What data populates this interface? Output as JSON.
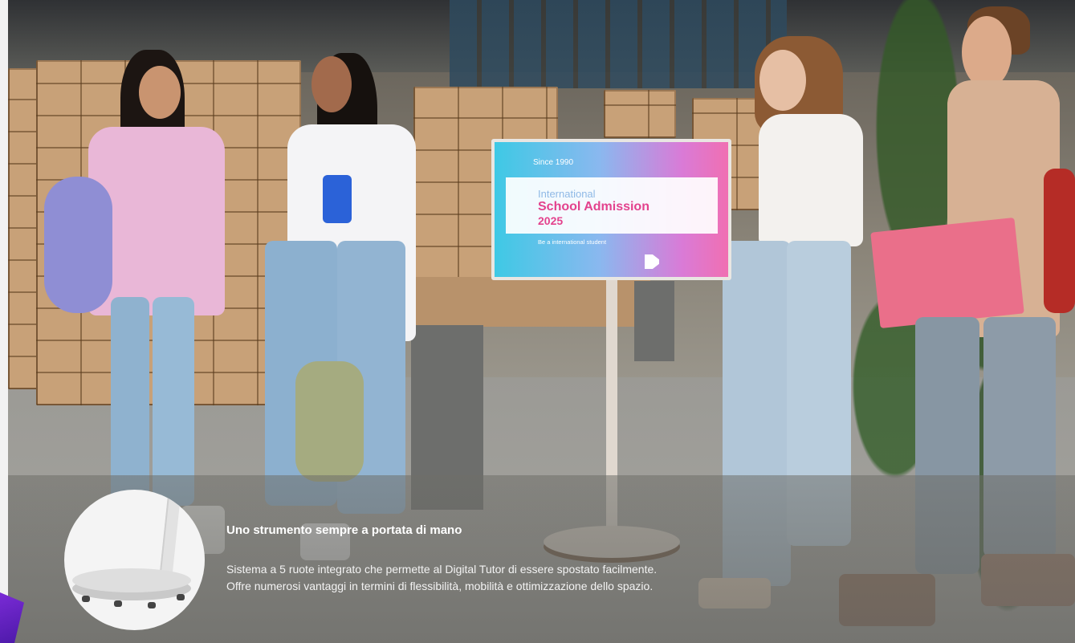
{
  "display": {
    "since": "Since 1990",
    "line1": "International",
    "line2": "School Admission",
    "line3": "2025",
    "subline": "Be a international student"
  },
  "caption": {
    "title": "Uno strumento sempre a portata di mano",
    "line1": "Sistema a 5 ruote integrato che permette al Digital Tutor di essere spostato facilmente.",
    "line2": "Offre numerosi vantaggi in termini di flessibilità, mobilità e ottimizzazione dello spazio."
  },
  "colors": {
    "accent_purple": "#6a25c8",
    "display_cyan": "#3ec9e5",
    "display_pink": "#e3428d"
  }
}
